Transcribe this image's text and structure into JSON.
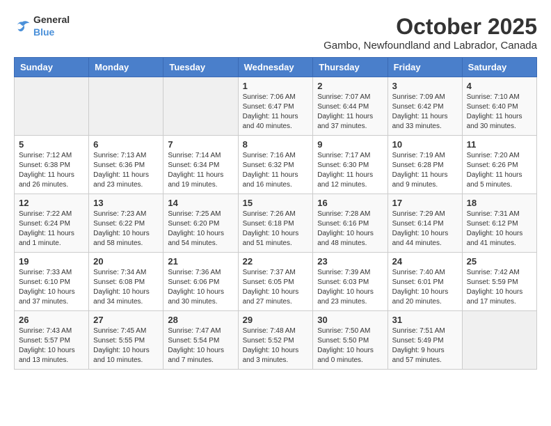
{
  "header": {
    "logo_general": "General",
    "logo_blue": "Blue",
    "month_title": "October 2025",
    "subtitle": "Gambo, Newfoundland and Labrador, Canada"
  },
  "weekdays": [
    "Sunday",
    "Monday",
    "Tuesday",
    "Wednesday",
    "Thursday",
    "Friday",
    "Saturday"
  ],
  "weeks": [
    [
      {
        "day": "",
        "info": ""
      },
      {
        "day": "",
        "info": ""
      },
      {
        "day": "",
        "info": ""
      },
      {
        "day": "1",
        "info": "Sunrise: 7:06 AM\nSunset: 6:47 PM\nDaylight: 11 hours\nand 40 minutes."
      },
      {
        "day": "2",
        "info": "Sunrise: 7:07 AM\nSunset: 6:44 PM\nDaylight: 11 hours\nand 37 minutes."
      },
      {
        "day": "3",
        "info": "Sunrise: 7:09 AM\nSunset: 6:42 PM\nDaylight: 11 hours\nand 33 minutes."
      },
      {
        "day": "4",
        "info": "Sunrise: 7:10 AM\nSunset: 6:40 PM\nDaylight: 11 hours\nand 30 minutes."
      }
    ],
    [
      {
        "day": "5",
        "info": "Sunrise: 7:12 AM\nSunset: 6:38 PM\nDaylight: 11 hours\nand 26 minutes."
      },
      {
        "day": "6",
        "info": "Sunrise: 7:13 AM\nSunset: 6:36 PM\nDaylight: 11 hours\nand 23 minutes."
      },
      {
        "day": "7",
        "info": "Sunrise: 7:14 AM\nSunset: 6:34 PM\nDaylight: 11 hours\nand 19 minutes."
      },
      {
        "day": "8",
        "info": "Sunrise: 7:16 AM\nSunset: 6:32 PM\nDaylight: 11 hours\nand 16 minutes."
      },
      {
        "day": "9",
        "info": "Sunrise: 7:17 AM\nSunset: 6:30 PM\nDaylight: 11 hours\nand 12 minutes."
      },
      {
        "day": "10",
        "info": "Sunrise: 7:19 AM\nSunset: 6:28 PM\nDaylight: 11 hours\nand 9 minutes."
      },
      {
        "day": "11",
        "info": "Sunrise: 7:20 AM\nSunset: 6:26 PM\nDaylight: 11 hours\nand 5 minutes."
      }
    ],
    [
      {
        "day": "12",
        "info": "Sunrise: 7:22 AM\nSunset: 6:24 PM\nDaylight: 11 hours\nand 1 minute."
      },
      {
        "day": "13",
        "info": "Sunrise: 7:23 AM\nSunset: 6:22 PM\nDaylight: 10 hours\nand 58 minutes."
      },
      {
        "day": "14",
        "info": "Sunrise: 7:25 AM\nSunset: 6:20 PM\nDaylight: 10 hours\nand 54 minutes."
      },
      {
        "day": "15",
        "info": "Sunrise: 7:26 AM\nSunset: 6:18 PM\nDaylight: 10 hours\nand 51 minutes."
      },
      {
        "day": "16",
        "info": "Sunrise: 7:28 AM\nSunset: 6:16 PM\nDaylight: 10 hours\nand 48 minutes."
      },
      {
        "day": "17",
        "info": "Sunrise: 7:29 AM\nSunset: 6:14 PM\nDaylight: 10 hours\nand 44 minutes."
      },
      {
        "day": "18",
        "info": "Sunrise: 7:31 AM\nSunset: 6:12 PM\nDaylight: 10 hours\nand 41 minutes."
      }
    ],
    [
      {
        "day": "19",
        "info": "Sunrise: 7:33 AM\nSunset: 6:10 PM\nDaylight: 10 hours\nand 37 minutes."
      },
      {
        "day": "20",
        "info": "Sunrise: 7:34 AM\nSunset: 6:08 PM\nDaylight: 10 hours\nand 34 minutes."
      },
      {
        "day": "21",
        "info": "Sunrise: 7:36 AM\nSunset: 6:06 PM\nDaylight: 10 hours\nand 30 minutes."
      },
      {
        "day": "22",
        "info": "Sunrise: 7:37 AM\nSunset: 6:05 PM\nDaylight: 10 hours\nand 27 minutes."
      },
      {
        "day": "23",
        "info": "Sunrise: 7:39 AM\nSunset: 6:03 PM\nDaylight: 10 hours\nand 23 minutes."
      },
      {
        "day": "24",
        "info": "Sunrise: 7:40 AM\nSunset: 6:01 PM\nDaylight: 10 hours\nand 20 minutes."
      },
      {
        "day": "25",
        "info": "Sunrise: 7:42 AM\nSunset: 5:59 PM\nDaylight: 10 hours\nand 17 minutes."
      }
    ],
    [
      {
        "day": "26",
        "info": "Sunrise: 7:43 AM\nSunset: 5:57 PM\nDaylight: 10 hours\nand 13 minutes."
      },
      {
        "day": "27",
        "info": "Sunrise: 7:45 AM\nSunset: 5:55 PM\nDaylight: 10 hours\nand 10 minutes."
      },
      {
        "day": "28",
        "info": "Sunrise: 7:47 AM\nSunset: 5:54 PM\nDaylight: 10 hours\nand 7 minutes."
      },
      {
        "day": "29",
        "info": "Sunrise: 7:48 AM\nSunset: 5:52 PM\nDaylight: 10 hours\nand 3 minutes."
      },
      {
        "day": "30",
        "info": "Sunrise: 7:50 AM\nSunset: 5:50 PM\nDaylight: 10 hours\nand 0 minutes."
      },
      {
        "day": "31",
        "info": "Sunrise: 7:51 AM\nSunset: 5:49 PM\nDaylight: 9 hours\nand 57 minutes."
      },
      {
        "day": "",
        "info": ""
      }
    ]
  ]
}
